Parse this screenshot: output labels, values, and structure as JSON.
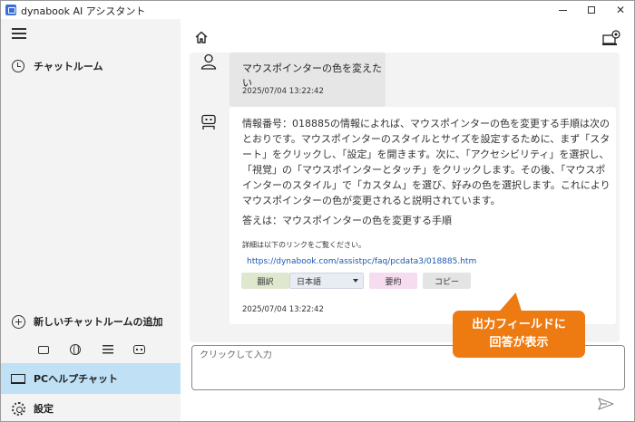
{
  "app": {
    "title": "dynabook AI アシスタント"
  },
  "sidebar": {
    "chatroom_label": "チャットルーム",
    "add_chatroom_label": "新しいチャットルームの追加",
    "pc_help_label": "PCヘルプチャット",
    "settings_label": "設定"
  },
  "conversation": {
    "user_message": "マウスポインターの色を変えたい",
    "user_timestamp": "2025/07/04 13:22:42",
    "bot_message": "情報番号：018885の情報によれば、マウスポインターの色を変更する手順は次のとおりです。マウスポインターのスタイルとサイズを設定するために、まず「スタート」をクリックし、「設定」を開きます。次に、「アクセシビリティ」を選択し、「視覚」の「マウスポインターとタッチ」をクリックします。その後、「マウスポインターのスタイル」で「カスタム」を選び、好みの色を選択します。これによりマウスポインターの色が変更されると説明されています。",
    "bot_answer": "答えは：マウスポインターの色を変更する手順",
    "detail_text": "詳細は以下のリンクをご覧ください。",
    "link_text": "https://dynabook.com/assistpc/faq/pcdata3/018885.htm",
    "translate_label": "翻訳",
    "language_value": "日本語",
    "summary_label": "要約",
    "copy_label": "コピー",
    "bot_timestamp": "2025/07/04 13:22:42"
  },
  "input": {
    "placeholder": "クリックして入力"
  },
  "callout": {
    "line1": "出力フィールドに",
    "line2": "回答が表示"
  },
  "colors": {
    "selected_nav": "#bfe0f5",
    "callout": "#ee7a12",
    "link": "#1a5ab0"
  }
}
